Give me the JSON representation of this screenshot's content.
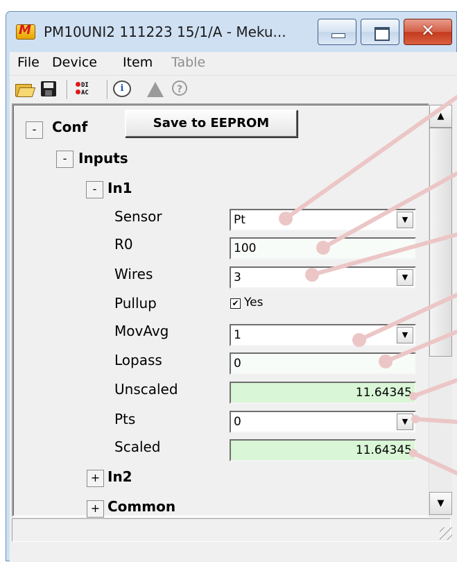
{
  "window": {
    "title": "PM10UNI2 111223 15/1/A - Meku...",
    "app_icon_letter": "M",
    "min_glyph": "",
    "max_glyph": "",
    "close_glyph": "✕"
  },
  "menu": [
    "File",
    "Device",
    "Item",
    "Table"
  ],
  "toolbar": {
    "dioac_line1": "DI",
    "dioac_line2": "AC",
    "info_glyph": "i",
    "help_glyph": "?"
  },
  "tree": {
    "conf": {
      "expander": "-",
      "label": "Conf"
    },
    "save_button": "Save to EEPROM",
    "inputs": {
      "expander": "-",
      "label": "Inputs"
    },
    "in1": {
      "expander": "-",
      "label": "In1"
    },
    "in2": {
      "expander": "+",
      "label": "In2"
    },
    "common": {
      "expander": "+",
      "label": "Common"
    }
  },
  "in1_properties": {
    "sensor": {
      "label": "Sensor",
      "value": "Pt"
    },
    "r0": {
      "label": "R0",
      "value": "100"
    },
    "wires": {
      "label": "Wires",
      "value": "3"
    },
    "pullup": {
      "label": "Pullup",
      "checked": true,
      "check_mark": "✔",
      "value": "Yes"
    },
    "movavg": {
      "label": "MovAvg",
      "value": "1"
    },
    "lopass": {
      "label": "Lopass",
      "value": "0"
    },
    "unscaled": {
      "label": "Unscaled",
      "value": "11.64345"
    },
    "pts": {
      "label": "Pts",
      "value": "0"
    },
    "scaled": {
      "label": "Scaled",
      "value": "11.64345"
    }
  },
  "scrollbar": {
    "up_arrow": "▲",
    "down_arrow": "▼"
  },
  "dropdown_arrow": "▼",
  "colors": {
    "readonly_field": "#d9f6d6",
    "callout": "#ecc6c6",
    "window_frame": "#cfe0f3",
    "close_button": "#c43a1e"
  }
}
